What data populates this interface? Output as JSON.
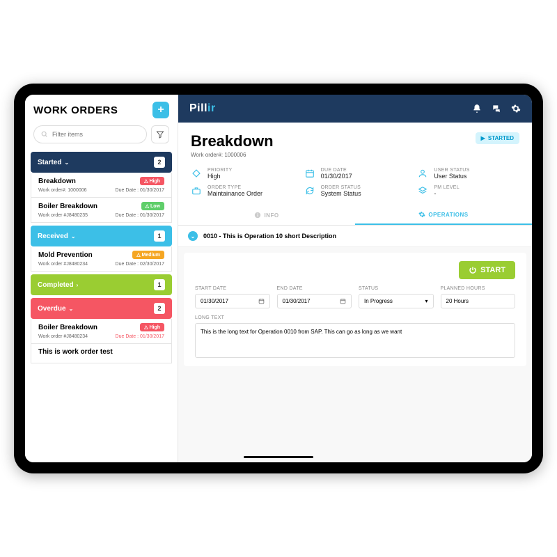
{
  "brand": {
    "name": "Pill",
    "accent": "ir"
  },
  "sidebar": {
    "title": "WORK ORDERS",
    "search_placeholder": "Filter items",
    "categories": [
      {
        "name": "Started",
        "count": "2",
        "expanded": true,
        "css": "cat-started",
        "items": [
          {
            "name": "Breakdown",
            "wo_label": "Work order#: 1000006",
            "due_label": "Due Date : 01/30/2017",
            "badge": "High",
            "badge_css": "badge-high"
          },
          {
            "name": "Boiler Breakdown",
            "wo_label": "Work order #J8480235",
            "due_label": "Due Date : 01/30/2017",
            "badge": "Low",
            "badge_css": "badge-low"
          }
        ]
      },
      {
        "name": "Received",
        "count": "1",
        "expanded": true,
        "css": "cat-received",
        "items": [
          {
            "name": "Mold Prevention",
            "wo_label": "Work order #J8480234",
            "due_label": "Due Date : 02/30/2017",
            "badge": "Medium",
            "badge_css": "badge-medium"
          }
        ]
      },
      {
        "name": "Completed",
        "count": "1",
        "expanded": false,
        "css": "cat-completed",
        "items": []
      },
      {
        "name": "Overdue",
        "count": "2",
        "expanded": true,
        "css": "cat-overdue",
        "items": [
          {
            "name": "Boiler Breakdown",
            "wo_label": "Work order #J8480234",
            "due_label": "Due Date : 01/30/2017",
            "badge": "High",
            "badge_css": "badge-high",
            "due_red": true
          },
          {
            "name": "This is work order test",
            "wo_label": "",
            "due_label": "",
            "badge": "",
            "badge_css": ""
          }
        ]
      }
    ]
  },
  "detail": {
    "title": "Breakdown",
    "work_order": "Work order#: 1000006",
    "status_pill": "STARTED",
    "meta": [
      {
        "label": "PRIORITY",
        "value": "High",
        "icon": "diamond"
      },
      {
        "label": "DUE DATE",
        "value": "01/30/2017",
        "icon": "calendar"
      },
      {
        "label": "USER STATUS",
        "value": "User Status",
        "icon": "user"
      },
      {
        "label": "ORDER TYPE",
        "value": "Maintainance Order",
        "icon": "briefcase"
      },
      {
        "label": "ORDER STATUS",
        "value": "System Status",
        "icon": "refresh"
      },
      {
        "label": "PM LEVEL",
        "value": "-",
        "icon": "layers"
      }
    ],
    "tabs": {
      "info": "INFO",
      "operations": "OPERATIONS"
    },
    "operation": {
      "header": "0010 - This is Operation 10 short Description",
      "start_btn": "START",
      "fields": {
        "start_date": {
          "label": "START DATE",
          "value": "01/30/2017"
        },
        "end_date": {
          "label": "END DATE",
          "value": "01/30/2017"
        },
        "status": {
          "label": "STATUS",
          "value": "In Progress"
        },
        "planned_hours": {
          "label": "PLANNED HOURS",
          "value": "20 Hours"
        }
      },
      "long_text_label": "LONG TEXT",
      "long_text": "This is the long text for  Operation 0010 from SAP. This can go as long as we want"
    }
  }
}
